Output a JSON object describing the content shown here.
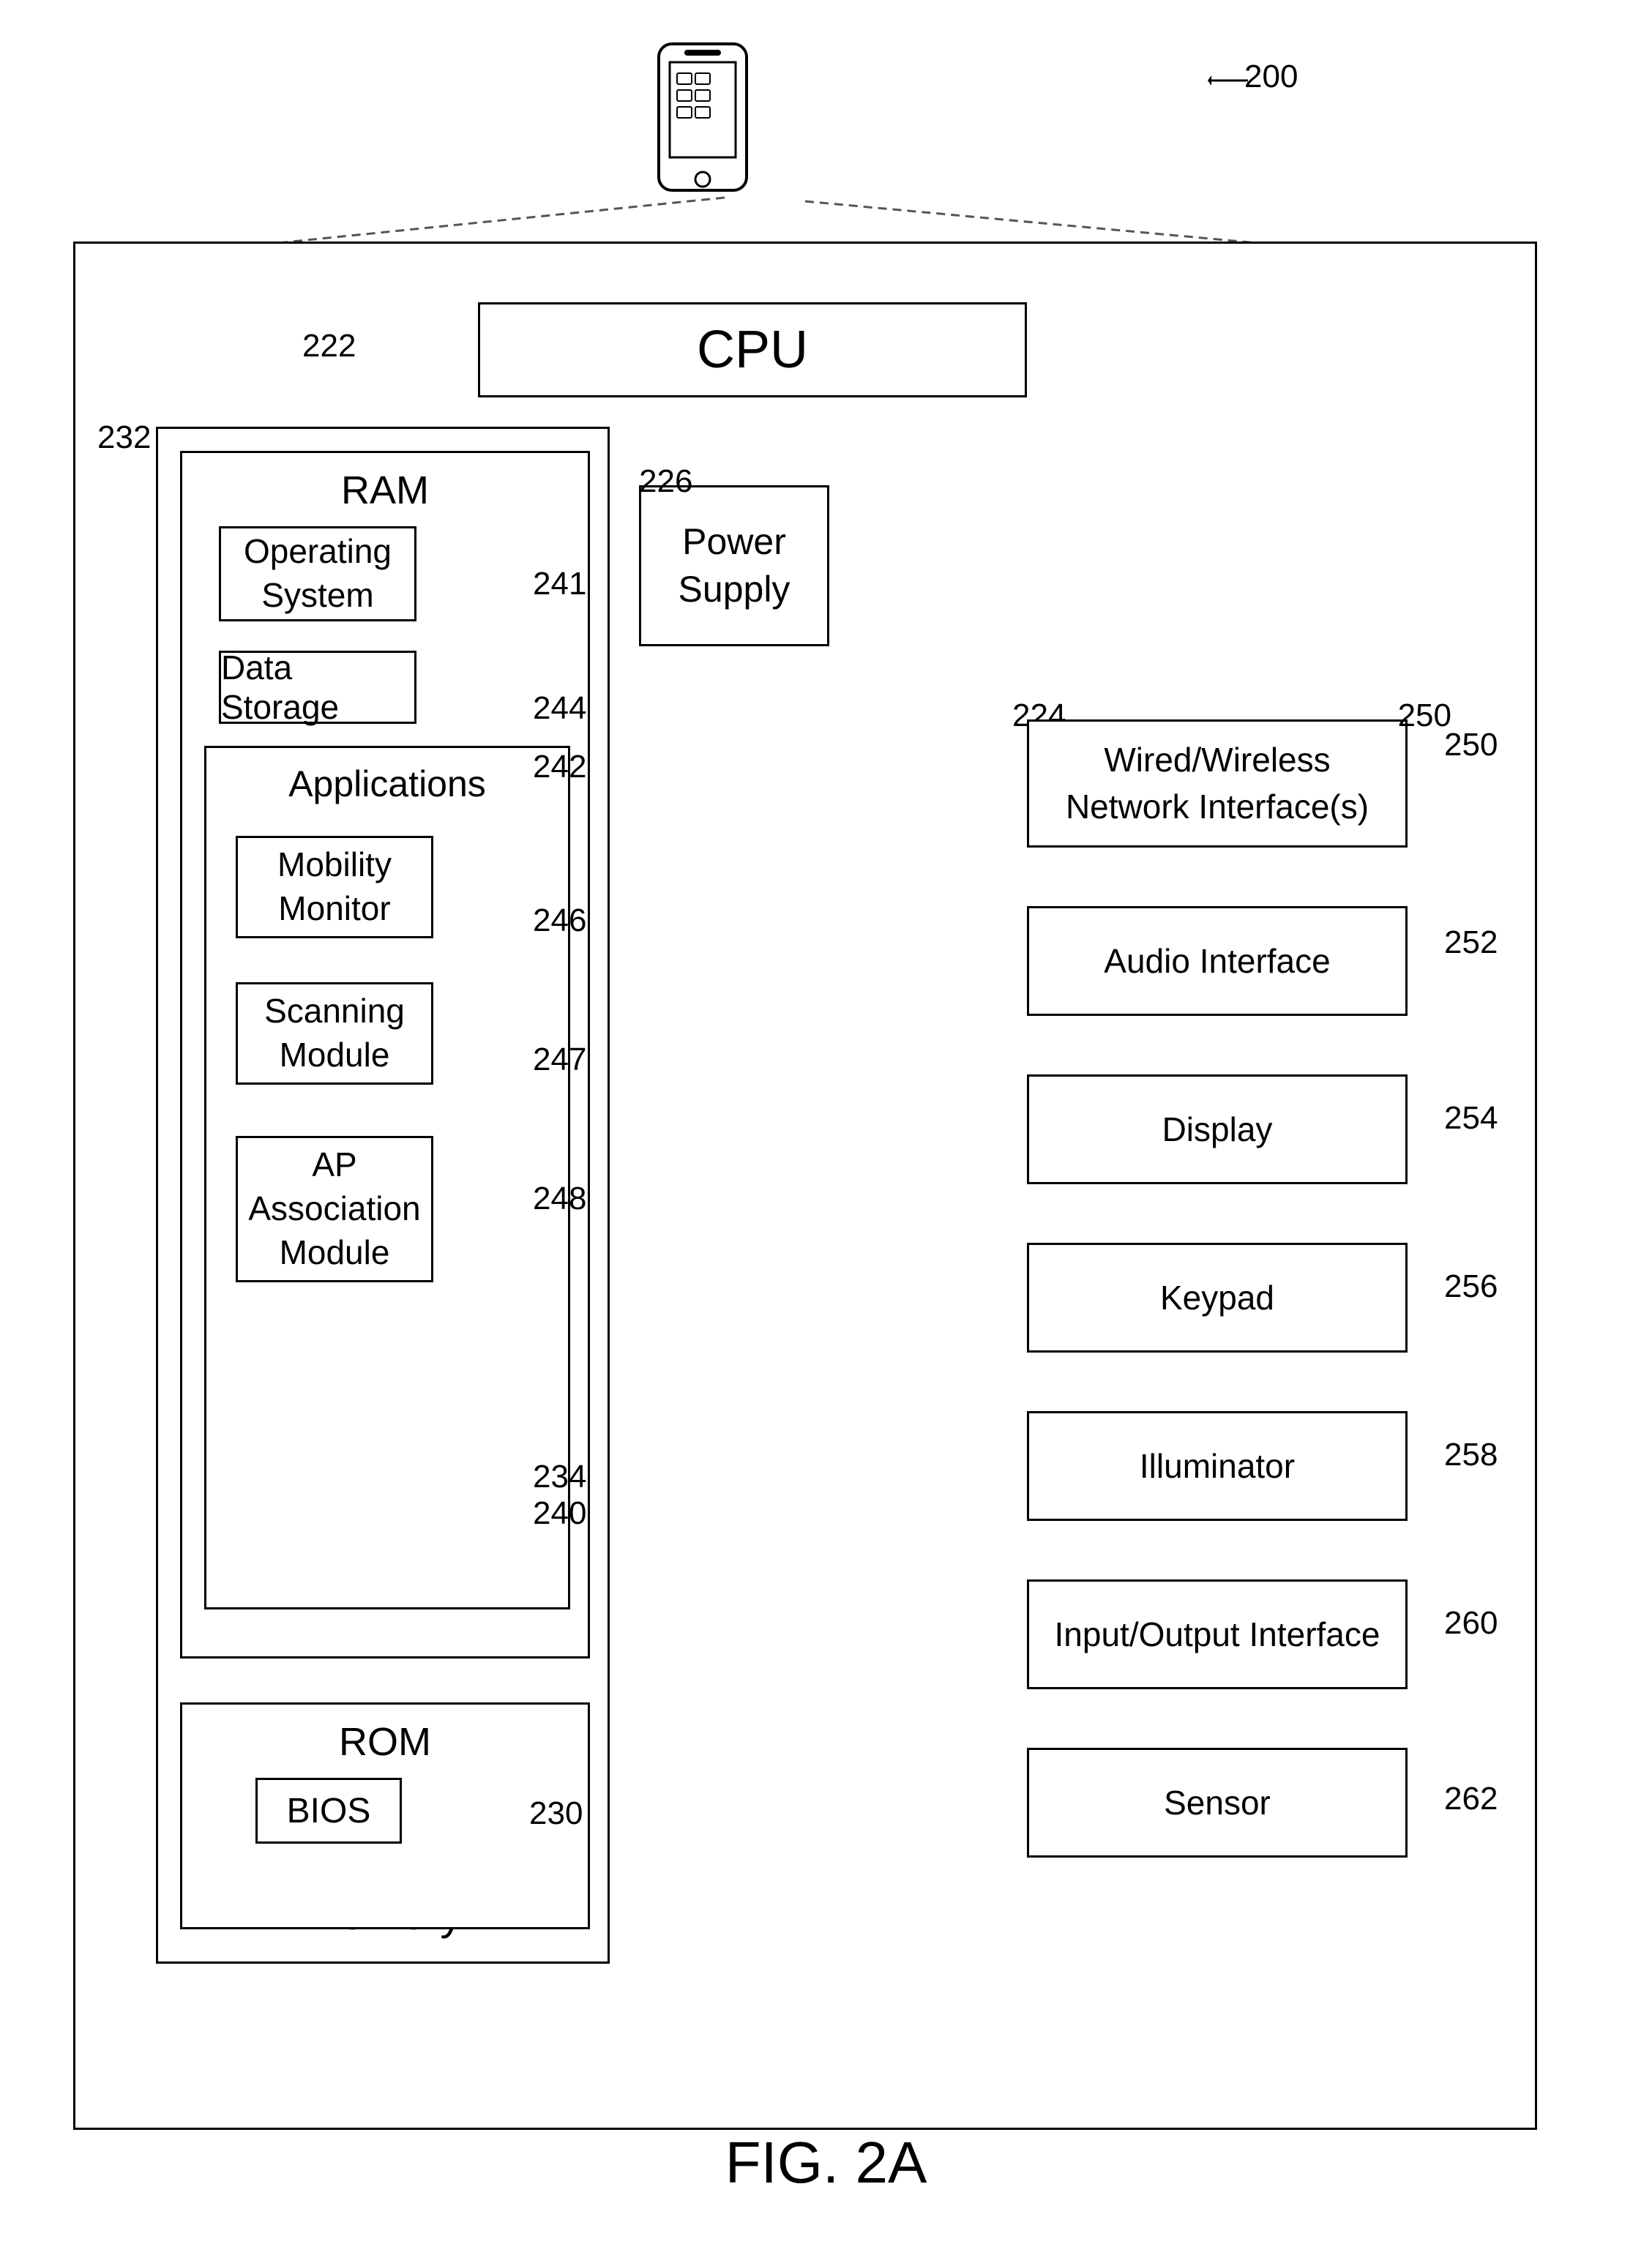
{
  "figure": {
    "label": "FIG. 2A",
    "ref_main": "200"
  },
  "components": {
    "cpu": {
      "label": "CPU",
      "ref": "222"
    },
    "power_supply": {
      "label": "Power Supply",
      "ref": "226"
    },
    "memory": {
      "label": "Memory",
      "ref": "230"
    },
    "ram": {
      "label": "RAM",
      "ref": "232"
    },
    "operating_system": {
      "label": "Operating System",
      "ref": "241"
    },
    "data_storage": {
      "label": "Data Storage",
      "ref": "244"
    },
    "applications": {
      "label": "Applications",
      "ref": "242"
    },
    "mobility_monitor": {
      "label": "Mobility Monitor",
      "ref": "246"
    },
    "scanning_module": {
      "label": "Scanning Module",
      "ref": "247"
    },
    "ap_association": {
      "label": "AP Association Module",
      "ref": "248"
    },
    "rom": {
      "label": "ROM",
      "ref": "234"
    },
    "bios": {
      "label": "BIOS",
      "ref": "240"
    },
    "network_interface": {
      "label": "Wired/Wireless Network Interface(s)",
      "ref": "250"
    },
    "audio_interface": {
      "label": "Audio Interface",
      "ref": "252"
    },
    "display": {
      "label": "Display",
      "ref": "254"
    },
    "keypad": {
      "label": "Keypad",
      "ref": "256"
    },
    "illuminator": {
      "label": "Illuminator",
      "ref": "258"
    },
    "io_interface": {
      "label": "Input/Output Interface",
      "ref": "260"
    },
    "sensor": {
      "label": "Sensor",
      "ref": "262"
    },
    "bus_ref": "224"
  }
}
